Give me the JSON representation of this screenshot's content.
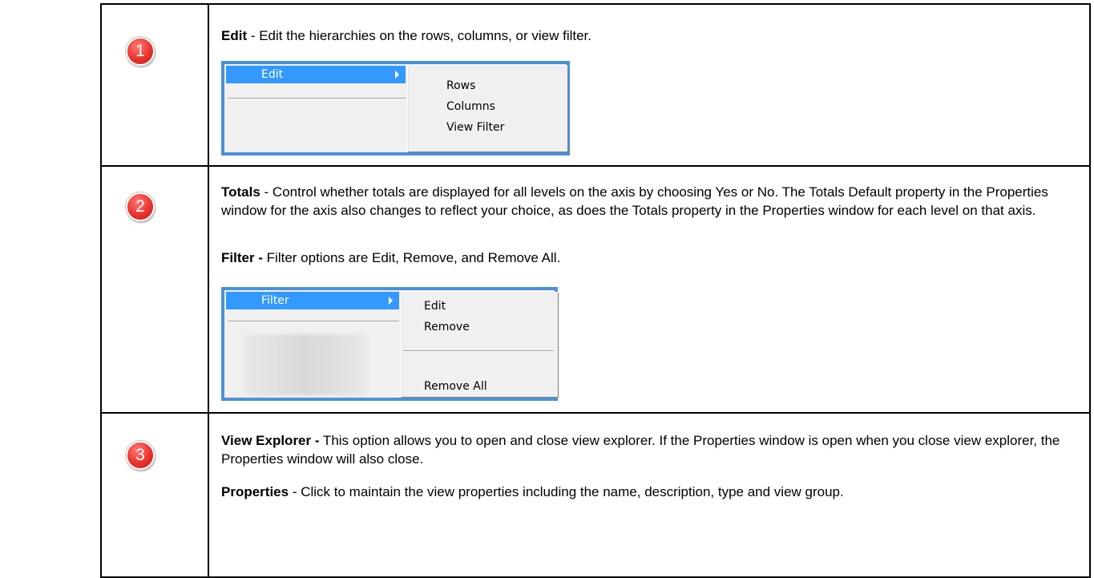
{
  "rows": [
    {
      "number": "1",
      "paragraphs": [
        {
          "bold": "Edit",
          "text": " - Edit the hierarchies on the rows, columns, or view filter."
        }
      ],
      "menu": {
        "highlighted": "Edit",
        "submenu": [
          "Rows",
          "Columns",
          "View Filter"
        ]
      }
    },
    {
      "number": "2",
      "paragraphs": [
        {
          "bold": "Totals",
          "text": " - Control whether totals are displayed for all levels on the axis by choosing Yes or No. The Totals Default property in the Properties window for the axis also changes to reflect your choice, as does the Totals property in the Properties window for each level on that axis."
        },
        {
          "bold": "Filter -",
          "text": " Filter options are Edit, Remove, and Remove All."
        }
      ],
      "menu": {
        "highlighted": "Filter",
        "submenu": [
          "Edit",
          "Remove",
          "Remove All"
        ]
      }
    },
    {
      "number": "3",
      "paragraphs": [
        {
          "bold": "View Explorer -",
          "text": " This option allows you to open and close view explorer. If the Properties window is open when you close view explorer, the Properties window will also close."
        },
        {
          "bold": "Properties",
          "text": " - Click to maintain the view properties including the name, description, type and view group."
        }
      ]
    }
  ],
  "colors": {
    "badge": "#e9322d",
    "menu_border": "#4a90d9",
    "highlight": "#3399ff"
  }
}
